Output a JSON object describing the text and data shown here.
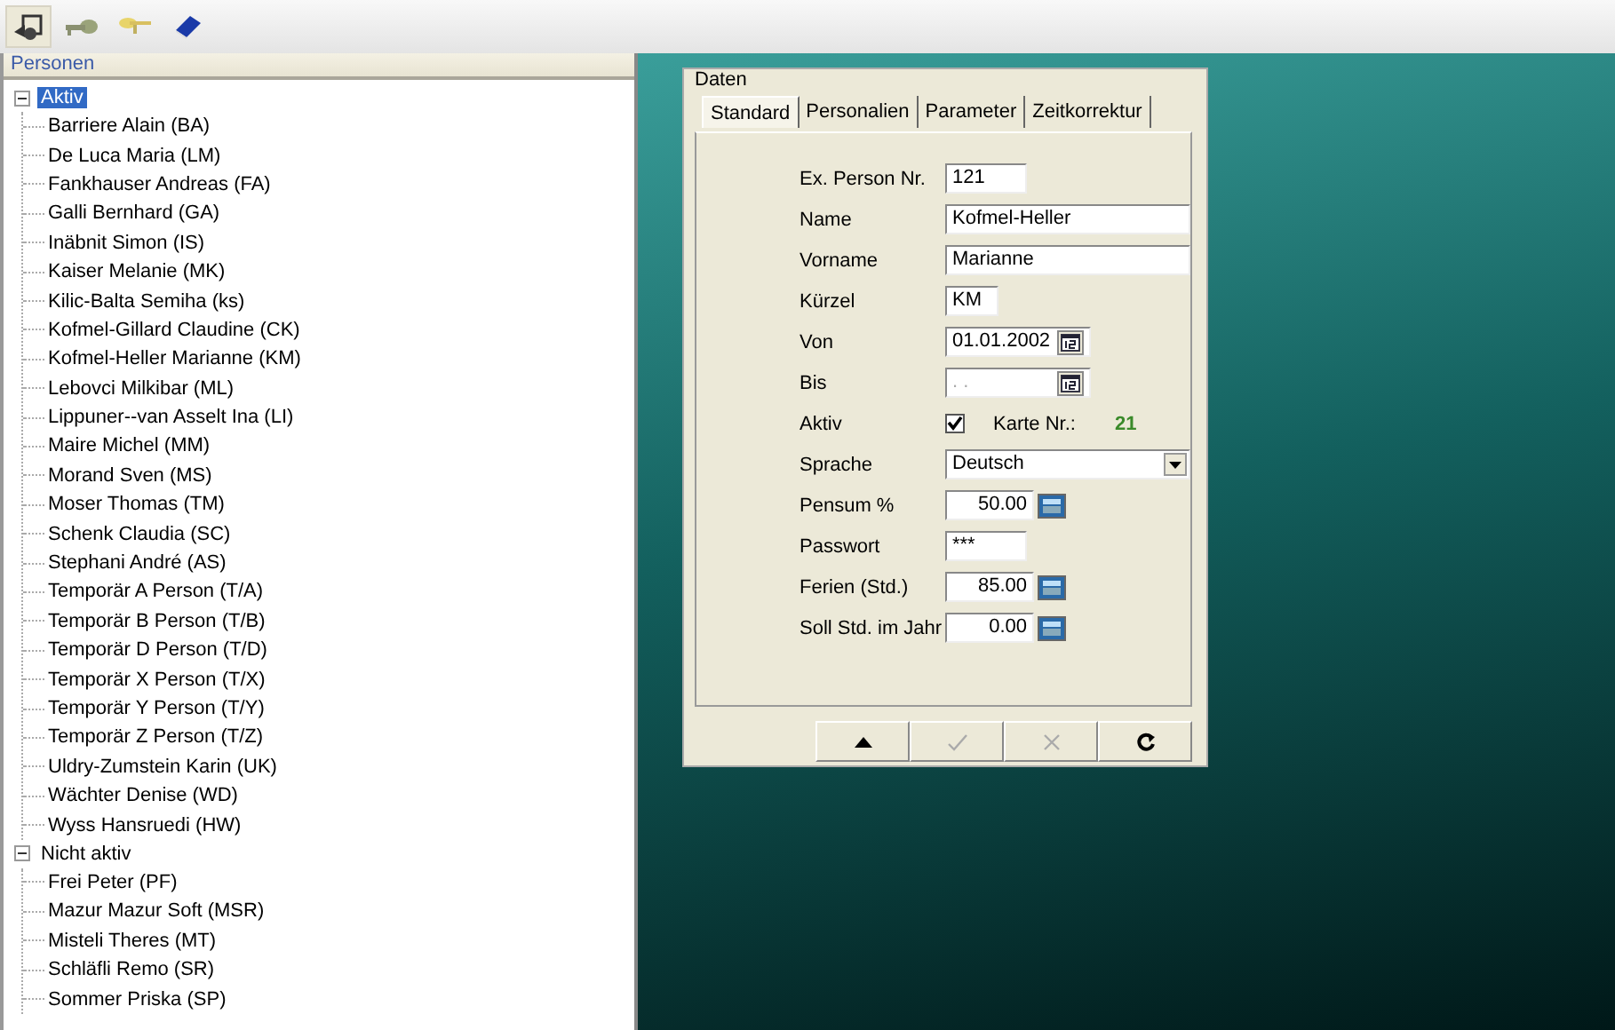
{
  "toolbar": [
    {
      "selected": true
    },
    {
      "selected": false
    },
    {
      "selected": false
    },
    {
      "selected": false
    }
  ],
  "tree": {
    "title": "Personen",
    "groups": [
      {
        "label": "Aktiv",
        "expanded": true,
        "selected": true,
        "children": [
          {
            "label": "Barriere Alain (BA)"
          },
          {
            "label": "De Luca Maria (LM)"
          },
          {
            "label": "Fankhauser Andreas (FA)"
          },
          {
            "label": "Galli Bernhard (GA)"
          },
          {
            "label": "Inäbnit Simon (IS)"
          },
          {
            "label": "Kaiser Melanie (MK)"
          },
          {
            "label": "Kilic-Balta Semiha (ks)"
          },
          {
            "label": "Kofmel-Gillard Claudine (CK)"
          },
          {
            "label": "Kofmel-Heller Marianne (KM)"
          },
          {
            "label": "Lebovci Milkibar (ML)"
          },
          {
            "label": "Lippuner--van Asselt Ina (LI)"
          },
          {
            "label": "Maire Michel (MM)"
          },
          {
            "label": "Morand Sven (MS)"
          },
          {
            "label": "Moser Thomas (TM)"
          },
          {
            "label": "Schenk Claudia (SC)"
          },
          {
            "label": "Stephani André (AS)"
          },
          {
            "label": "Temporär A Person (T/A)"
          },
          {
            "label": "Temporär B Person (T/B)"
          },
          {
            "label": "Temporär D Person (T/D)"
          },
          {
            "label": "Temporär X  Person (T/X)"
          },
          {
            "label": "Temporär Y Person (T/Y)"
          },
          {
            "label": "Temporär Z Person (T/Z)"
          },
          {
            "label": "Uldry-Zumstein Karin (UK)"
          },
          {
            "label": "Wächter Denise (WD)"
          },
          {
            "label": "Wyss Hansruedi (HW)"
          }
        ]
      },
      {
        "label": "Nicht aktiv",
        "expanded": true,
        "selected": false,
        "children": [
          {
            "label": "Frei Peter (PF)"
          },
          {
            "label": "Mazur Mazur Soft (MSR)"
          },
          {
            "label": "Misteli Theres (MT)"
          },
          {
            "label": "Schläfli Remo (SR)"
          },
          {
            "label": "Sommer Priska (SP)"
          }
        ]
      }
    ]
  },
  "dialog": {
    "title": "Daten",
    "tabs": [
      {
        "label": "Standard",
        "selected": true
      },
      {
        "label": "Personalien",
        "selected": false
      },
      {
        "label": "Parameter",
        "selected": false
      },
      {
        "label": "Zeitkorrektur",
        "selected": false
      }
    ],
    "fields": [
      {
        "kind": "text",
        "label": "Ex. Person Nr.",
        "value": "121"
      },
      {
        "kind": "text",
        "label": "Name",
        "value": "Kofmel-Heller"
      },
      {
        "kind": "text",
        "label": "Vorname",
        "value": "Marianne"
      },
      {
        "kind": "text",
        "label": "Kürzel",
        "value": "KM"
      },
      {
        "kind": "date",
        "label": "Von",
        "value": "01.01.2002"
      },
      {
        "kind": "date",
        "label": "Bis",
        "placeholder": ". ."
      },
      {
        "kind": "checkbox",
        "label": "Aktiv",
        "checked": true,
        "extra_label": "Karte Nr.:",
        "extra_value": "21"
      },
      {
        "kind": "select",
        "label": "Sprache",
        "value": "Deutsch"
      },
      {
        "kind": "number",
        "label": "Pensum %",
        "value": "50.00"
      },
      {
        "kind": "text",
        "label": "Passwort",
        "value": "***"
      },
      {
        "kind": "number",
        "label": "Ferien (Std.)",
        "value": "85.00"
      },
      {
        "kind": "number",
        "label": "Soll Std. im Jahr",
        "value": "0.00"
      }
    ],
    "buttons": [
      {
        "kind": "up",
        "disabled": false
      },
      {
        "kind": "check",
        "disabled": true
      },
      {
        "kind": "cancel",
        "disabled": true
      },
      {
        "kind": "refresh",
        "disabled": false
      }
    ]
  }
}
